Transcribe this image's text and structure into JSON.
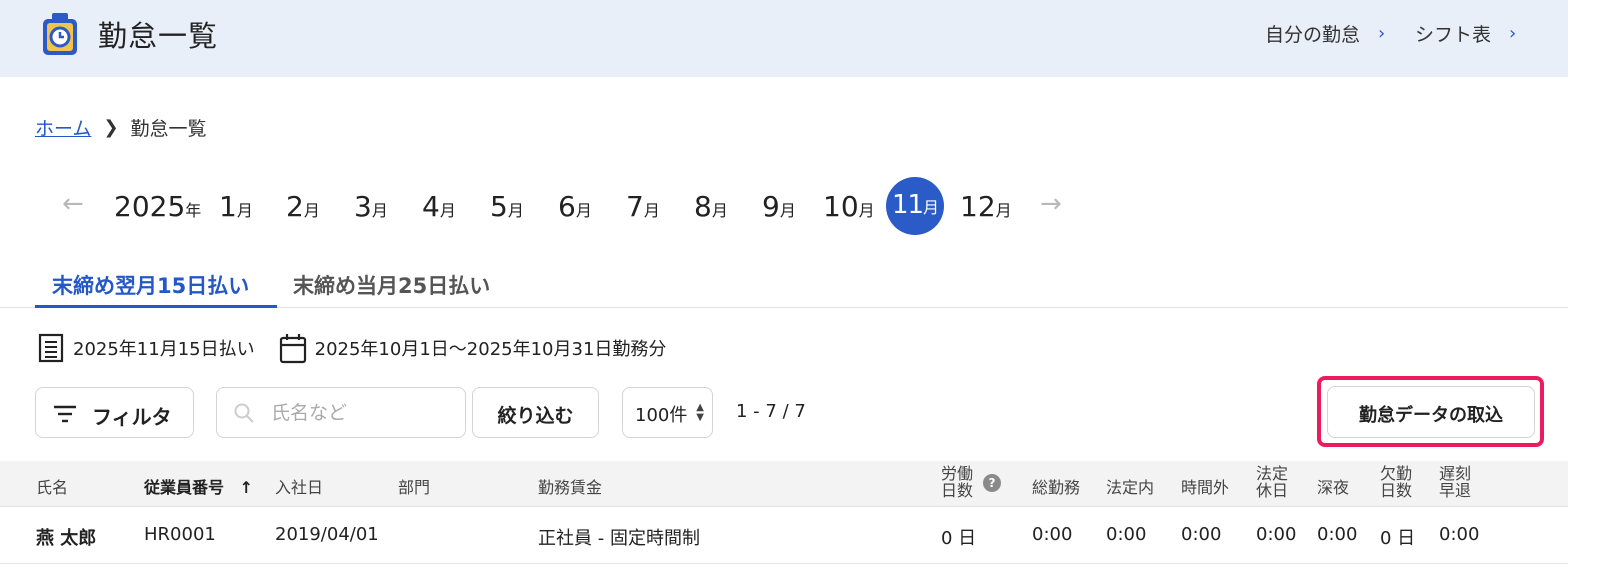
{
  "header": {
    "title": "勤怠一覧",
    "links": [
      {
        "label": "自分の勤怠"
      },
      {
        "label": "シフト表"
      }
    ]
  },
  "breadcrumb": {
    "home": "ホーム",
    "current": "勤怠一覧"
  },
  "month_nav": {
    "year": "2025",
    "year_suffix": "年",
    "month_suffix": "月",
    "months": [
      "1",
      "2",
      "3",
      "4",
      "5",
      "6",
      "7",
      "8",
      "9",
      "10",
      "11",
      "12"
    ],
    "selected_month": "11",
    "prev_arrow": "←",
    "next_arrow": "→"
  },
  "tabs": [
    {
      "label": "末締め翌月15日払い",
      "active": true
    },
    {
      "label": "末締め当月25日払い",
      "active": false
    }
  ],
  "pay_info": {
    "payday": "2025年11月15日払い",
    "period": "2025年10月1日～2025年10月31日勤務分"
  },
  "toolbar": {
    "filter_label": "フィルタ",
    "search_placeholder": "氏名など",
    "search_value": "",
    "narrow_label": "絞り込む",
    "per_page": "100件",
    "range": "1 - 7 / 7",
    "import_label": "勤怠データの取込"
  },
  "table": {
    "columns": {
      "name": "氏名",
      "employee_no": "従業員番号",
      "sort_indicator": "↑",
      "hire_date": "入社日",
      "department": "部門",
      "wage": "勤務賃金",
      "work_days_1": "労働",
      "work_days_2": "日数",
      "help": "?",
      "total_work": "総勤務",
      "statutory": "法定内",
      "overtime": "時間外",
      "holiday_1": "法定",
      "holiday_2": "休日",
      "night": "深夜",
      "absence_1": "欠勤",
      "absence_2": "日数",
      "late_1": "遅刻",
      "late_2": "早退"
    },
    "rows": [
      {
        "name": "燕 太郎",
        "employee_no": "HR0001",
        "hire_date": "2019/04/01",
        "department": "",
        "wage": "正社員 - 固定時間制",
        "work_days": "0 日",
        "total_work": "0:00",
        "statutory": "0:00",
        "overtime": "0:00",
        "holiday": "0:00",
        "night": "0:00",
        "absence": "0 日",
        "late": "0:00"
      }
    ]
  },
  "colors": {
    "accent": "#2458c8",
    "active_month": "#2a5bc6",
    "highlight": "#ec1b5d",
    "header_bg": "#e9eff8"
  }
}
